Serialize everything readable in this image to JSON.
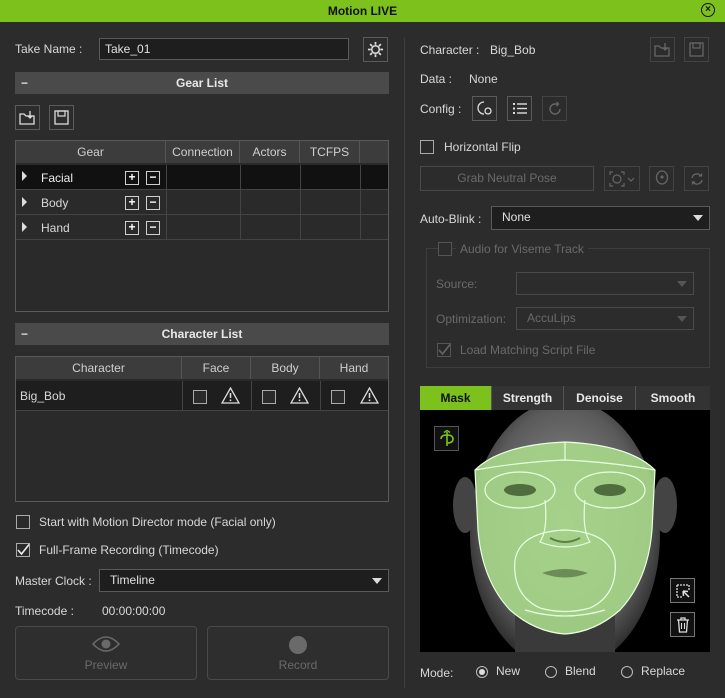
{
  "window": {
    "title": "Motion LIVE"
  },
  "take": {
    "label": "Take Name :",
    "value": "Take_01"
  },
  "gear_list": {
    "title": "Gear List",
    "columns": [
      "Gear",
      "Connection",
      "Actors",
      "TCFPS"
    ],
    "rows": [
      {
        "name": "Facial"
      },
      {
        "name": "Body"
      },
      {
        "name": "Hand"
      }
    ]
  },
  "character_list": {
    "title": "Character List",
    "columns": [
      "Character",
      "Face",
      "Body",
      "Hand"
    ],
    "rows": [
      {
        "name": "Big_Bob"
      }
    ]
  },
  "options": {
    "motion_director": "Start with Motion Director mode (Facial only)",
    "full_frame": "Full-Frame Recording (Timecode)",
    "full_frame_checked": true
  },
  "master_clock": {
    "label": "Master Clock :",
    "value": "Timeline"
  },
  "timecode": {
    "label": "Timecode :",
    "value": "00:00:00:00"
  },
  "buttons": {
    "preview": "Preview",
    "record": "Record"
  },
  "right": {
    "character_label": "Character :",
    "character_value": "Big_Bob",
    "data_label": "Data :",
    "data_value": "None",
    "config_label": "Config :",
    "horizontal_flip": "Horizontal Flip",
    "grab_neutral_pose": "Grab Neutral Pose",
    "auto_blink_label": "Auto-Blink :",
    "auto_blink_value": "None",
    "audio_viseme": "Audio for Viseme Track",
    "source_label": "Source:",
    "source_value": "",
    "optimization_label": "Optimization:",
    "optimization_value": "AccuLips",
    "load_script": "Load Matching Script File"
  },
  "mask_tabs": [
    "Mask",
    "Strength",
    "Denoise",
    "Smooth"
  ],
  "mode": {
    "label": "Mode:",
    "options": [
      "New",
      "Blend",
      "Replace"
    ],
    "selected": "New"
  },
  "colors": {
    "accent": "#7dc11c",
    "background": "#2c2c2c",
    "mask_fill": "#a6d68a"
  }
}
